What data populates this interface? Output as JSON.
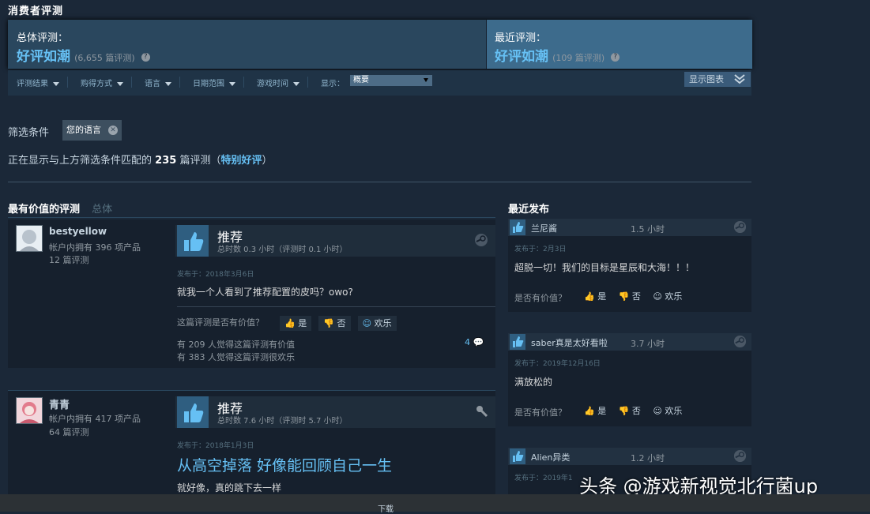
{
  "section_title": "消费者评测",
  "summary": {
    "overall_label": "总体评测：",
    "overall_value": "好评如潮",
    "overall_count": "(6,655 篇评测)",
    "recent_label": "最近评测：",
    "recent_value": "好评如潮",
    "recent_count": "(109 篇评测)"
  },
  "filters": {
    "items": [
      "评测结果",
      "购得方式",
      "语言",
      "日期范围",
      "游戏时间"
    ],
    "display_label": "显示：",
    "display_value": "概要",
    "show_graph": "显示图表"
  },
  "filter_conditions": {
    "label": "筛选条件",
    "tag": "您的语言",
    "showing_prefix": "正在显示与上方筛选条件匹配的",
    "showing_count": "235",
    "showing_suffix": "篇评测（",
    "showing_link": "特别好评",
    "showing_close": "）"
  },
  "columns": {
    "helpful_title": "最有价值的评测",
    "helpful_sub": "总体",
    "recent_title": "最近发布"
  },
  "reviews": [
    {
      "username": "bestyellow",
      "products": "帐户内拥有 396 项产品",
      "reviews": "12 篇评测",
      "verdict": "推荐",
      "hours": "总时数 0.3 小时（评测时 0.1 小时）",
      "posted": "发布于：2018年3月6日",
      "text": "就我一个人看到了推荐配置的皮吗？owo?",
      "helpful_q": "这篇评测是否有价值？",
      "yes": "是",
      "no": "否",
      "funny": "欢乐",
      "helpful_count": "有 209 人觉得这篇评测有价值",
      "funny_count": "有 383 人觉得这篇评测很欢乐",
      "comments": "4"
    },
    {
      "username": "青青",
      "products": "帐户内拥有 417 项产品",
      "reviews": "64 篇评测",
      "verdict": "推荐",
      "hours": "总时数 7.6 小时（评测时 5.7 小时）",
      "posted": "发布于：2018年1月3日",
      "headline": "从高空掉落 好像能回顾自己一生",
      "text": "就好像，真的跳下去一样"
    }
  ],
  "recent": [
    {
      "username": "兰尼酱",
      "hours": "1.5 小时",
      "posted": "发布于：2月3日",
      "text": "超脱一切！我们的目标是星辰和大海！！！",
      "helpful_q": "是否有价值？",
      "yes": "是",
      "no": "否",
      "funny": "欢乐"
    },
    {
      "username": "saber真是太好看啦",
      "hours": "3.7 小时",
      "posted": "发布于：2019年12月16日",
      "text": "满放松的",
      "helpful_q": "是否有价值？",
      "yes": "是",
      "no": "否",
      "funny": "欢乐"
    },
    {
      "username": "Alien异类",
      "hours": "1.2 小时",
      "posted": "发布于：2019年1"
    }
  ],
  "watermark": "头条 @游戏新视觉北行菌up",
  "footer": "下载"
}
